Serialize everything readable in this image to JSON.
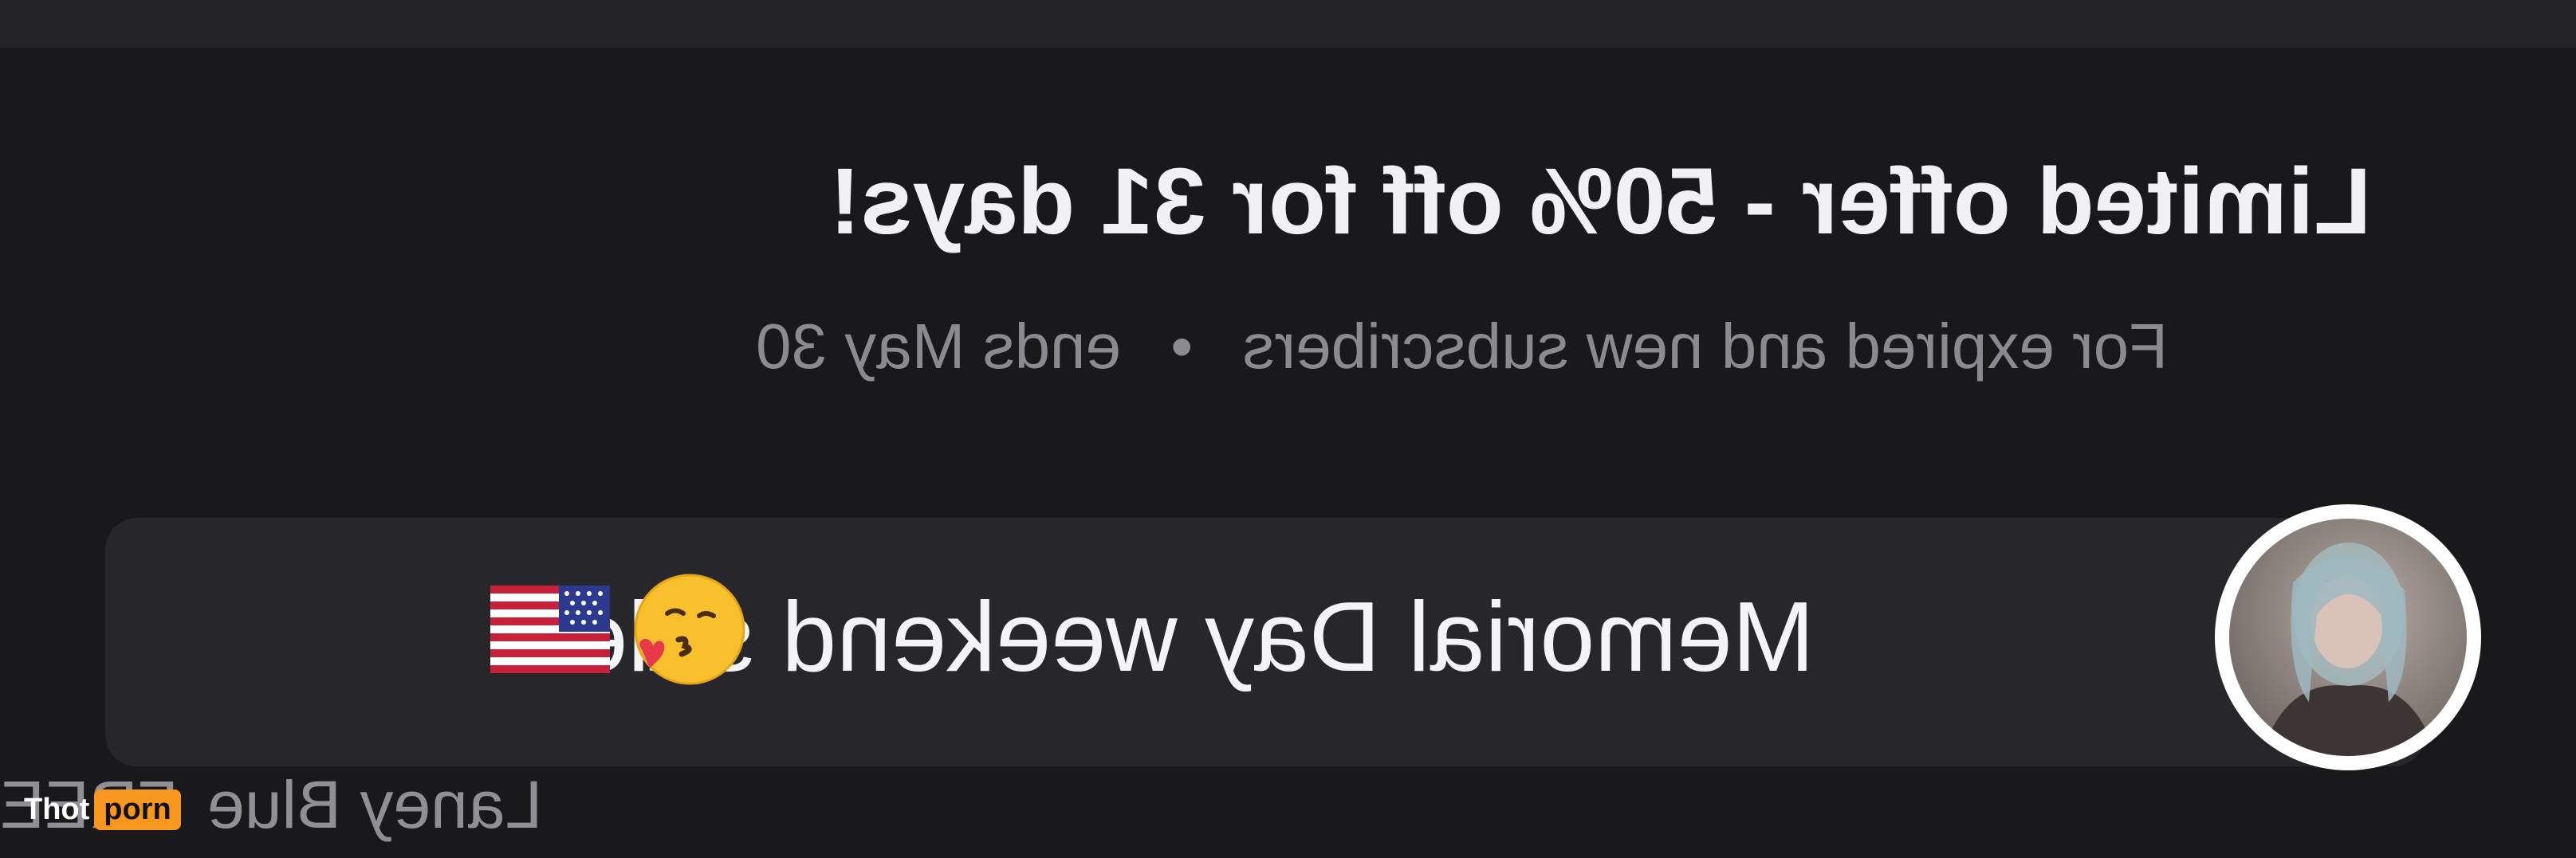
{
  "offer": {
    "title": "Limited offer - 50% off for 31 days!",
    "audience": "For expired and new subscribers",
    "separator": "•",
    "ends": "ends May 30"
  },
  "message": {
    "text": "Memorial Day weekend sale!!!",
    "emojis": [
      "kissing-face-with-heart-emoji",
      "us-flag-emoji"
    ]
  },
  "sender": {
    "name": "Laney Blue",
    "badge": "FREE"
  },
  "watermark": {
    "part1": "Thot",
    "part2": "porn"
  },
  "colors": {
    "background": "#19191b",
    "card": "#27272b",
    "accent": "#f7971e"
  }
}
